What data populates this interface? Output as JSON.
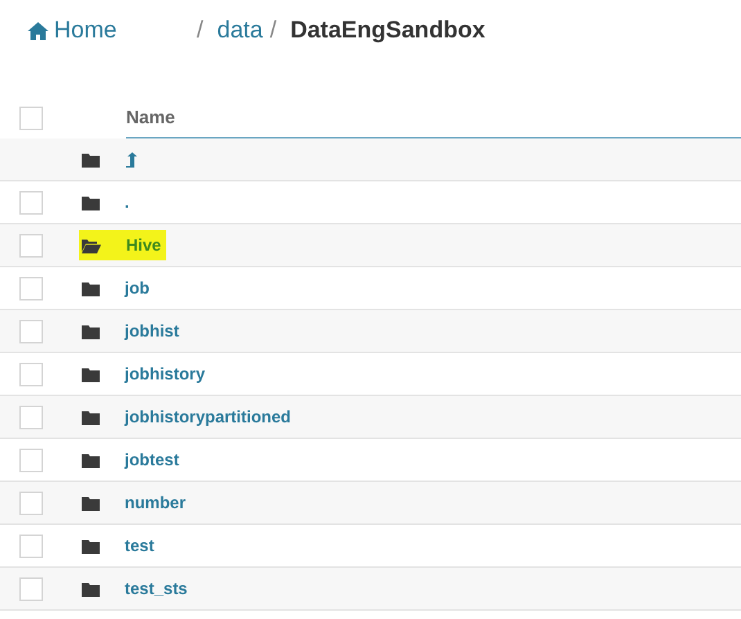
{
  "breadcrumb": {
    "home": "Home",
    "separator_1": "/",
    "path": "data",
    "separator_2": "/",
    "current": "DataEngSandbox"
  },
  "table": {
    "select_all_checked": false,
    "columns": [
      "Name"
    ],
    "rows": [
      {
        "kind": "parent",
        "highlighted": false
      },
      {
        "kind": "folder",
        "name": ".",
        "checked": false,
        "highlighted": false
      },
      {
        "kind": "folder",
        "name": "Hive",
        "checked": false,
        "highlighted": true
      },
      {
        "kind": "folder",
        "name": "job",
        "checked": false,
        "highlighted": false
      },
      {
        "kind": "folder",
        "name": "jobhist",
        "checked": false,
        "highlighted": false
      },
      {
        "kind": "folder",
        "name": "jobhistory",
        "checked": false,
        "highlighted": false
      },
      {
        "kind": "folder",
        "name": "jobhistorypartitioned",
        "checked": false,
        "highlighted": false
      },
      {
        "kind": "folder",
        "name": "jobtest",
        "checked": false,
        "highlighted": false
      },
      {
        "kind": "folder",
        "name": "number",
        "checked": false,
        "highlighted": false
      },
      {
        "kind": "folder",
        "name": "test",
        "checked": false,
        "highlighted": false
      },
      {
        "kind": "folder",
        "name": "test_sts",
        "checked": false,
        "highlighted": false
      }
    ]
  }
}
